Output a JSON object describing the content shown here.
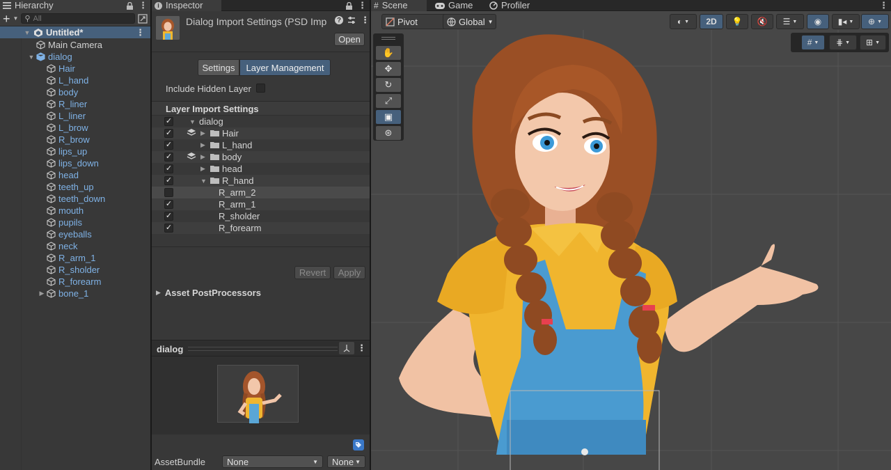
{
  "hierarchy": {
    "tab_title": "Hierarchy",
    "search_placeholder": "All",
    "scene_name": "Untitled*",
    "items": [
      {
        "label": "Main Camera",
        "depth": 1
      },
      {
        "label": "dialog",
        "depth": 1
      },
      {
        "label": "Hair",
        "depth": 2
      },
      {
        "label": "L_hand",
        "depth": 2
      },
      {
        "label": "body",
        "depth": 2
      },
      {
        "label": "R_liner",
        "depth": 2
      },
      {
        "label": "L_liner",
        "depth": 2
      },
      {
        "label": "L_brow",
        "depth": 2
      },
      {
        "label": "R_brow",
        "depth": 2
      },
      {
        "label": "lips_up",
        "depth": 2
      },
      {
        "label": "lips_down",
        "depth": 2
      },
      {
        "label": "head",
        "depth": 2
      },
      {
        "label": "teeth_up",
        "depth": 2
      },
      {
        "label": "teeth_down",
        "depth": 2
      },
      {
        "label": "mouth",
        "depth": 2
      },
      {
        "label": "pupils",
        "depth": 2
      },
      {
        "label": "eyeballs",
        "depth": 2
      },
      {
        "label": "neck",
        "depth": 2
      },
      {
        "label": "R_arm_1",
        "depth": 2
      },
      {
        "label": "R_sholder",
        "depth": 2
      },
      {
        "label": "R_forearm",
        "depth": 2
      },
      {
        "label": "bone_1",
        "depth": 2
      }
    ]
  },
  "inspector": {
    "tab_title": "Inspector",
    "asset_title": "Dialog Import Settings (PSD Imp",
    "open_label": "Open",
    "tab_settings": "Settings",
    "tab_layer_management": "Layer Management",
    "include_hidden_label": "Include Hidden Layer",
    "layer_import_header": "Layer Import Settings",
    "layers": [
      {
        "label": "dialog",
        "checked": true
      },
      {
        "label": "Hair",
        "checked": true
      },
      {
        "label": "L_hand",
        "checked": true
      },
      {
        "label": "body",
        "checked": true
      },
      {
        "label": "head",
        "checked": true
      },
      {
        "label": "R_hand",
        "checked": true
      },
      {
        "label": "R_arm_2",
        "checked": false
      },
      {
        "label": "R_arm_1",
        "checked": true
      },
      {
        "label": "R_sholder",
        "checked": true
      },
      {
        "label": "R_forearm",
        "checked": true
      }
    ],
    "revert_label": "Revert",
    "apply_label": "Apply",
    "postprocessors_label": "Asset PostProcessors",
    "preview_title": "dialog",
    "assetbundle_label": "AssetBundle",
    "assetbundle_value": "None",
    "assetbundle_variant": "None"
  },
  "scene": {
    "tab_scene": "Scene",
    "tab_game": "Game",
    "tab_profiler": "Profiler",
    "pivot_label": "Pivot",
    "global_label": "Global",
    "mode_2d": "2D"
  },
  "colors": {
    "selection": "#46607c",
    "prefab_blue": "#7fb2e6",
    "panel": "#383838",
    "scene_bg": "#474747"
  }
}
